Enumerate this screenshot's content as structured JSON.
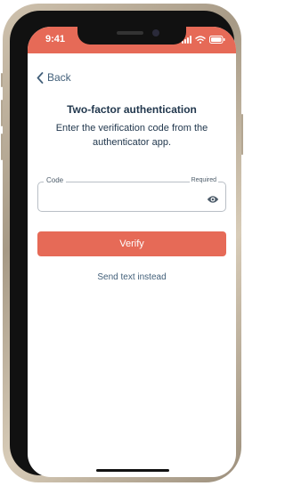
{
  "status_bar": {
    "time": "9:41",
    "background_color": "#e66a57",
    "icons": [
      "cellular-signal-icon",
      "wifi-icon",
      "battery-icon"
    ]
  },
  "nav": {
    "back_label": "Back",
    "back_icon": "chevron-left-icon"
  },
  "header": {
    "title": "Two-factor authentication",
    "subtitle": "Enter the verification code from the authenticator app."
  },
  "code_field": {
    "label": "Code",
    "required_label": "Required",
    "value": "",
    "visibility_icon": "eye-icon"
  },
  "verify_button": {
    "label": "Verify",
    "color": "#e66a57"
  },
  "alternate_action": {
    "label": "Send text instead"
  },
  "colors": {
    "accent": "#e66a57",
    "text_dark": "#22384e",
    "link": "#43607a"
  }
}
